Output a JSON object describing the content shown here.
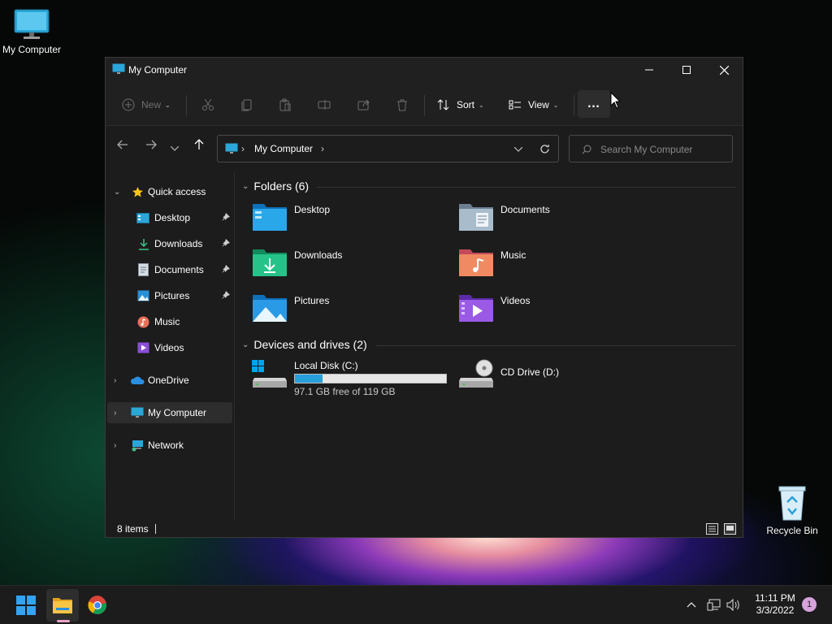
{
  "desktop": {
    "icons": [
      {
        "label": "My Computer"
      },
      {
        "label": "Recycle Bin"
      }
    ]
  },
  "window": {
    "title": "My Computer",
    "commands": {
      "new": "New",
      "sort": "Sort",
      "view": "View",
      "more": "…"
    },
    "address": {
      "crumb": "My Computer"
    },
    "search": {
      "placeholder": "Search My Computer"
    },
    "sidebar": {
      "quick_access": "Quick access",
      "items": [
        {
          "label": "Desktop",
          "pinned": true
        },
        {
          "label": "Downloads",
          "pinned": true
        },
        {
          "label": "Documents",
          "pinned": true
        },
        {
          "label": "Pictures",
          "pinned": true
        },
        {
          "label": "Music",
          "pinned": false
        },
        {
          "label": "Videos",
          "pinned": false
        }
      ],
      "onedrive": "OneDrive",
      "my_computer": "My Computer",
      "network": "Network"
    },
    "content": {
      "folders_header": "Folders (6)",
      "folders": [
        {
          "name": "Desktop",
          "icon": "desktop-folder-icon"
        },
        {
          "name": "Documents",
          "icon": "documents-folder-icon"
        },
        {
          "name": "Downloads",
          "icon": "downloads-folder-icon"
        },
        {
          "name": "Music",
          "icon": "music-folder-icon"
        },
        {
          "name": "Pictures",
          "icon": "pictures-folder-icon"
        },
        {
          "name": "Videos",
          "icon": "videos-folder-icon"
        }
      ],
      "drives_header": "Devices and drives (2)",
      "drives": [
        {
          "name": "Local Disk (C:)",
          "free_text": "97.1 GB free of 119 GB",
          "used_fraction": 0.184
        },
        {
          "name": "CD Drive (D:)"
        }
      ]
    },
    "status": {
      "items": "8 items"
    }
  },
  "taskbar": {
    "time": "11:11 PM",
    "date": "3/3/2022",
    "notifications": "1"
  },
  "colors": {
    "accent": "#26a0da",
    "window_bg": "#1c1c1c",
    "selected_bg": "#2d2d2d"
  }
}
